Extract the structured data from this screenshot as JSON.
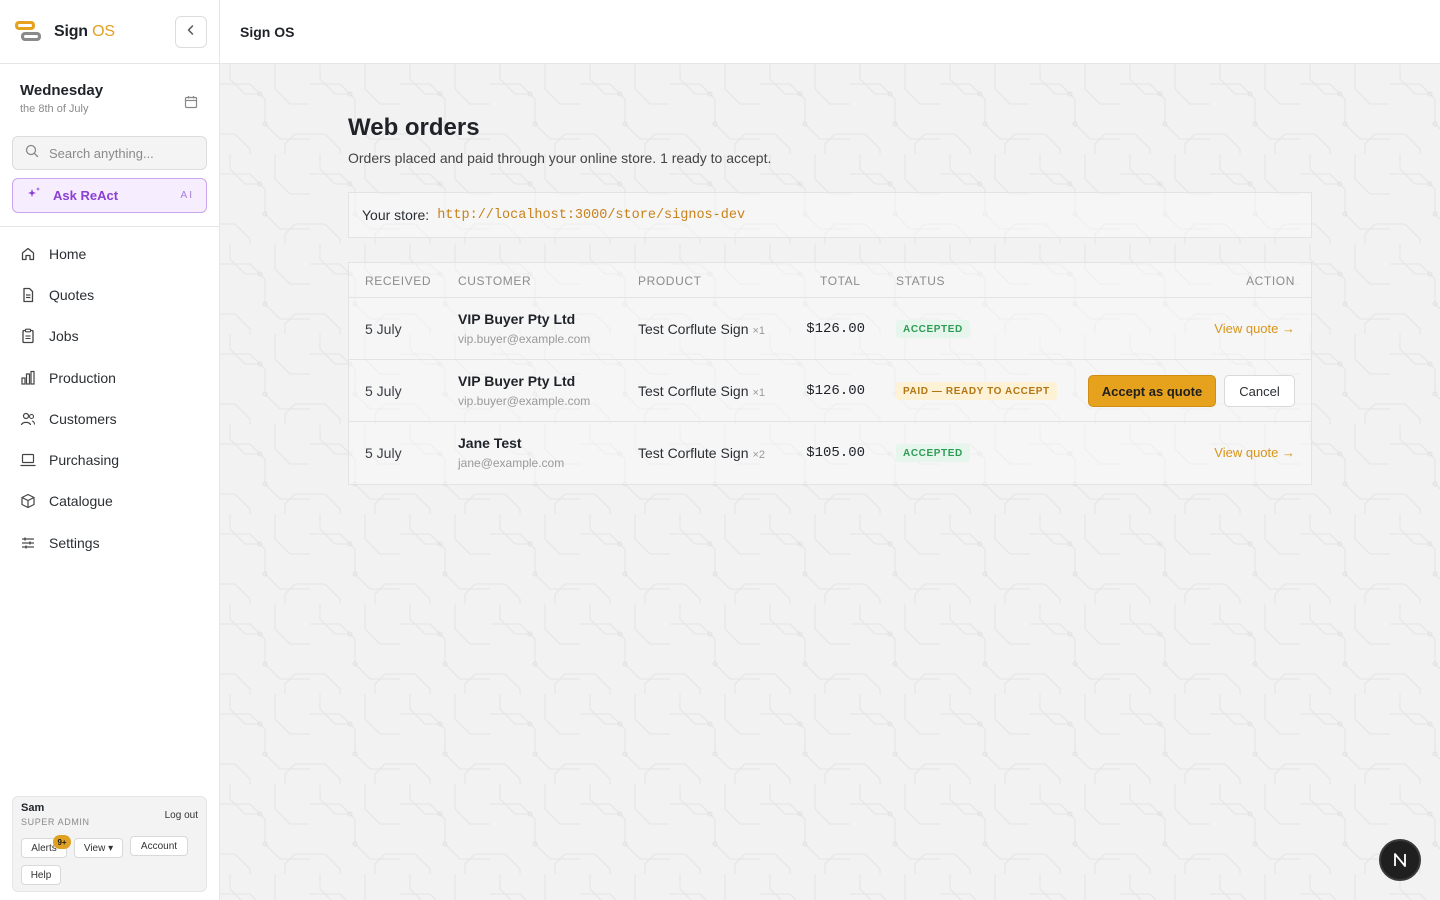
{
  "brand": {
    "name_part1": "Sign",
    "name_part2": "OS"
  },
  "sidebar": {
    "date_day": "Wednesday",
    "date_sub": "the 8th of July",
    "search_placeholder": "Search anything...",
    "ask_label": "Ask ReAct",
    "ask_tag": "AI",
    "items": [
      {
        "label": "Home",
        "icon": "home-icon"
      },
      {
        "label": "Quotes",
        "icon": "document-icon"
      },
      {
        "label": "Jobs",
        "icon": "clipboard-icon"
      },
      {
        "label": "Production",
        "icon": "bar-chart-icon"
      },
      {
        "label": "Customers",
        "icon": "users-icon"
      },
      {
        "label": "Purchasing",
        "icon": "laptop-icon"
      },
      {
        "label": "Catalogue",
        "icon": "box-icon"
      },
      {
        "label": "Settings",
        "icon": "sliders-icon"
      }
    ],
    "user": {
      "name": "Sam",
      "role": "SUPER ADMIN",
      "logout": "Log out",
      "alerts": "Alerts",
      "alerts_badge": "9+",
      "view": "View ▾",
      "account": "Account",
      "help": "Help"
    }
  },
  "topbar": {
    "title": "Sign OS"
  },
  "main": {
    "title": "Web orders",
    "subtitle": "Orders placed and paid through your online store. 1 ready to accept.",
    "store_label": "Your store:",
    "store_url": "http://localhost:3000/store/signos-dev",
    "columns": [
      "RECEIVED",
      "CUSTOMER",
      "PRODUCT",
      "TOTAL",
      "STATUS",
      "ACTION"
    ],
    "rows": [
      {
        "received": "5 July",
        "customer": "VIP Buyer Pty Ltd",
        "email": "vip.buyer@example.com",
        "product": "Test Corflute Sign",
        "qty": "×1",
        "total": "$126.00",
        "status": "ACCEPTED",
        "action": "View quote →"
      },
      {
        "received": "5 July",
        "customer": "VIP Buyer Pty Ltd",
        "email": "vip.buyer@example.com",
        "product": "Test Corflute Sign",
        "qty": "×1",
        "total": "$126.00",
        "status": "PAID — READY TO ACCEPT",
        "accept": "Accept as quote",
        "cancel": "Cancel"
      },
      {
        "received": "5 July",
        "customer": "Jane Test",
        "email": "jane@example.com",
        "product": "Test Corflute Sign",
        "qty": "×2",
        "total": "$105.00",
        "status": "ACCEPTED",
        "action": "View quote →"
      }
    ]
  },
  "fab": {
    "label": "N"
  },
  "colors": {
    "accent": "#e6a11d",
    "ai_purple": "#8b3fd4",
    "accepted_green": "#2e9b55"
  }
}
